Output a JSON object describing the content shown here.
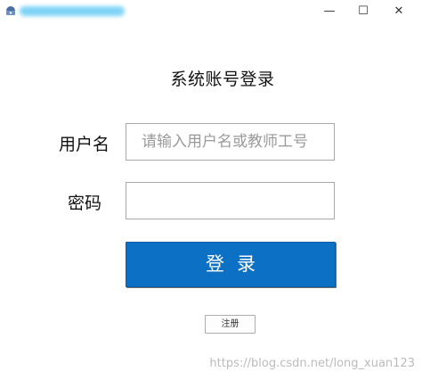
{
  "window": {
    "minimize_glyph": "—",
    "maximize_glyph": "☐",
    "close_glyph": "✕"
  },
  "form": {
    "title": "系统账号登录",
    "username_label": "用户名",
    "username_placeholder": "请输入用户名或教师工号",
    "username_value": "",
    "password_label": "密码",
    "password_value": "",
    "login_label": "登录",
    "register_label": "注册"
  },
  "watermark": "https://blog.csdn.net/long_xuan123",
  "colors": {
    "primary_button": "#0c70c4",
    "background": "#ffffff"
  }
}
